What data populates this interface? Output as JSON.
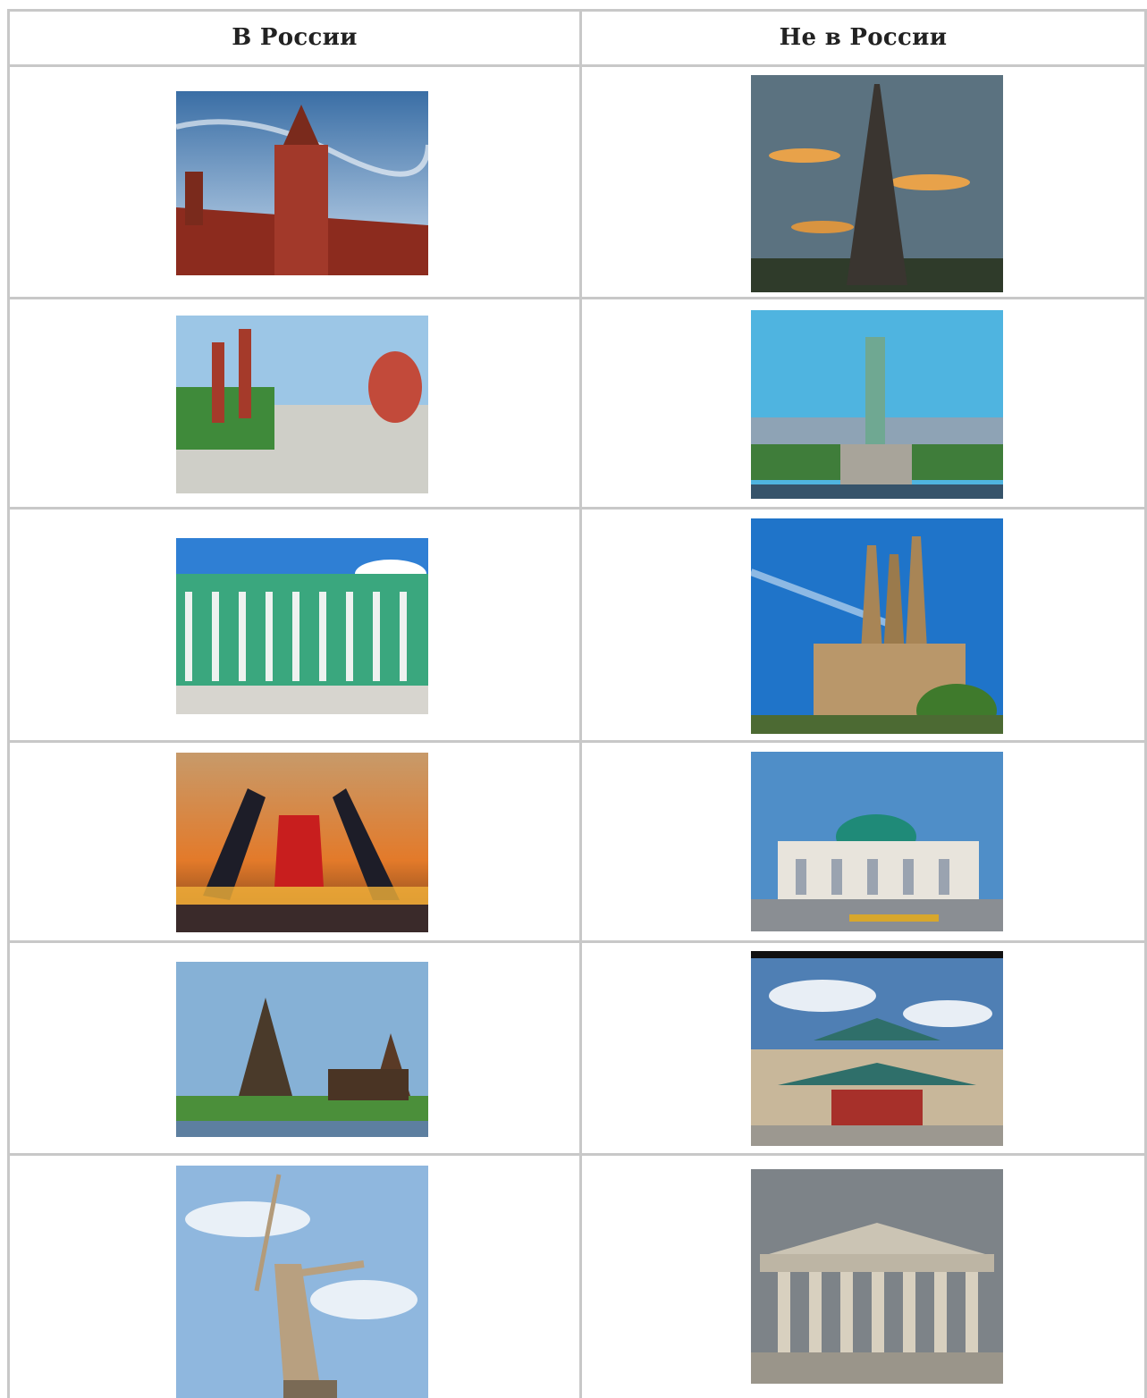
{
  "table": {
    "headers": [
      "В России",
      "Не в России"
    ],
    "rows": [
      {
        "left": "kremlin-spasskaya-tower-photo",
        "right": "eiffel-tower-photo"
      },
      {
        "left": "red-square-photo",
        "right": "statue-of-liberty-photo"
      },
      {
        "left": "winter-palace-photo",
        "right": "sagrada-familia-photo"
      },
      {
        "left": "scarlet-sails-bridge-photo",
        "right": "domed-museum-photo"
      },
      {
        "left": "kizhi-wooden-churches-photo",
        "right": "chinese-style-building-photo"
      },
      {
        "left": "motherland-calls-statue-photo",
        "right": "british-museum-photo"
      }
    ]
  }
}
